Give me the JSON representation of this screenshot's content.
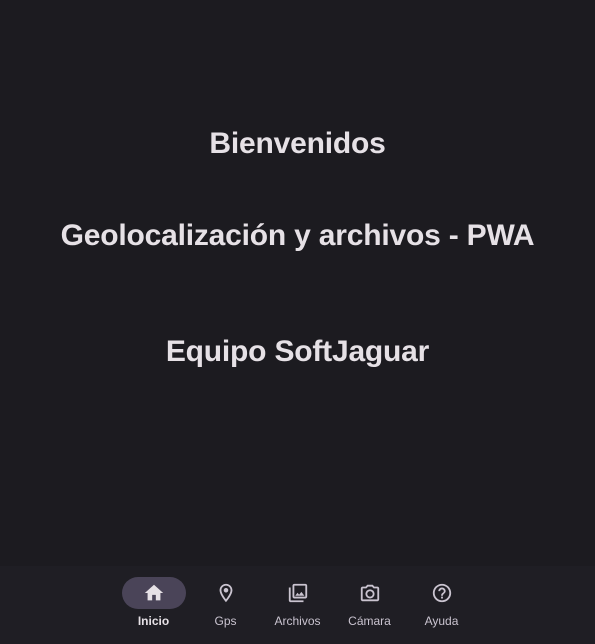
{
  "main": {
    "welcome": "Bienvenidos",
    "app_title": "Geolocalización y archivos - PWA",
    "team": "Equipo SoftJaguar"
  },
  "nav": {
    "active_index": 0,
    "items": [
      {
        "label": "Inicio",
        "icon": "home-icon"
      },
      {
        "label": "Gps",
        "icon": "location-pin-icon"
      },
      {
        "label": "Archivos",
        "icon": "photo-library-icon"
      },
      {
        "label": "Cámara",
        "icon": "camera-icon"
      },
      {
        "label": "Ayuda",
        "icon": "help-circle-icon"
      }
    ]
  },
  "colors": {
    "background": "#1c1b20",
    "nav_background": "#1f1e24",
    "active_indicator": "#4a4458",
    "text": "#e6e1e6",
    "muted_text": "#cac4d0"
  }
}
